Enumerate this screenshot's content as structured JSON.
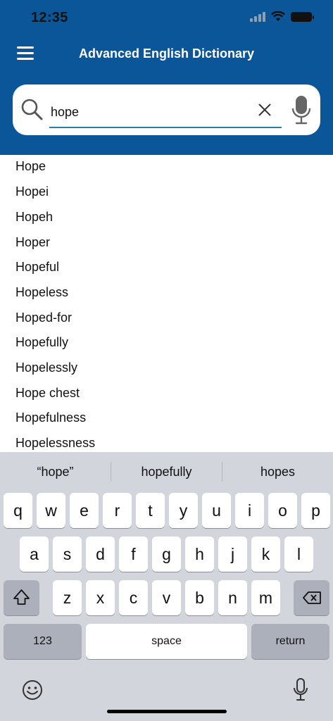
{
  "status_bar": {
    "time": "12:35"
  },
  "header": {
    "title": "Advanced English Dictionary"
  },
  "search": {
    "value": "hope",
    "placeholder": ""
  },
  "results": [
    "Hope",
    "Hopei",
    "Hopeh",
    "Hoper",
    "Hopeful",
    "Hopeless",
    "Hoped-for",
    "Hopefully",
    "Hopelessly",
    "Hope chest",
    "Hopefulness",
    "Hopelessness"
  ],
  "keyboard": {
    "suggestions": [
      "“hope”",
      "hopefully",
      "hopes"
    ],
    "row1": [
      "q",
      "w",
      "e",
      "r",
      "t",
      "y",
      "u",
      "i",
      "o",
      "p"
    ],
    "row2": [
      "a",
      "s",
      "d",
      "f",
      "g",
      "h",
      "j",
      "k",
      "l"
    ],
    "row3": [
      "z",
      "x",
      "c",
      "v",
      "b",
      "n",
      "m"
    ],
    "numbers_label": "123",
    "space_label": "space",
    "return_label": "return"
  },
  "colors": {
    "header_bg": "#0b5699",
    "keyboard_bg": "#d2d5db",
    "underline": "#2a7fa7"
  }
}
